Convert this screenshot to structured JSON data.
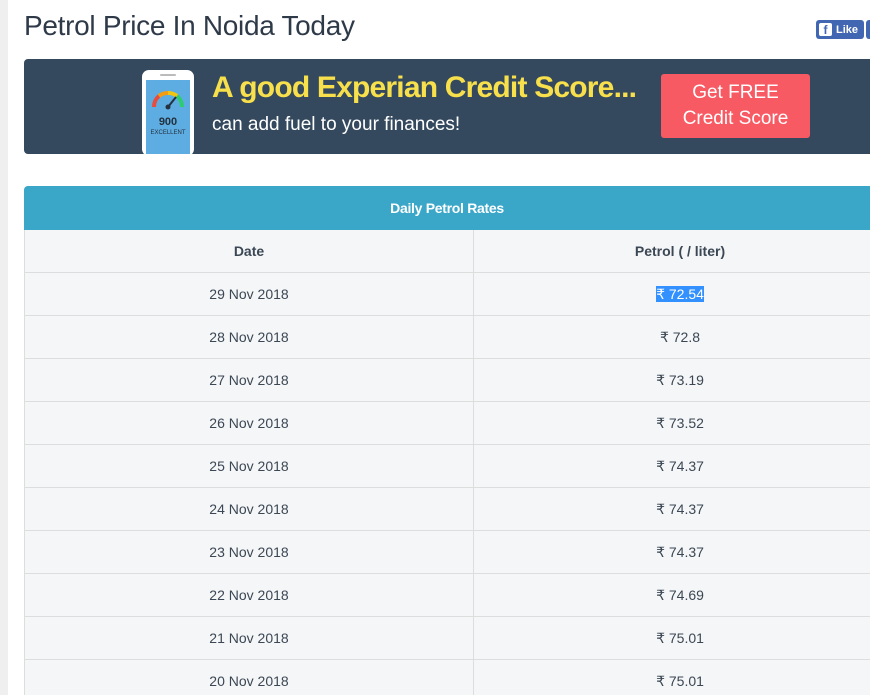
{
  "page": {
    "title": "Petrol Price In Noida Today"
  },
  "social": {
    "like_label": "Like",
    "fb_glyph": "f"
  },
  "banner": {
    "headline": "A good Experian Credit Score...",
    "subtext": "can add fuel to your finances!",
    "cta": {
      "line1": "Get FREE",
      "line2": "Credit Score"
    },
    "phone": {
      "score": "900",
      "label": "EXCELLENT"
    },
    "colors": {
      "background": "#34495e",
      "headline": "#f7e04b",
      "cta": "#f75a63",
      "phone_screen": "#5dade2"
    }
  },
  "rates": {
    "title": "Daily Petrol Rates",
    "columns": [
      "Date",
      "Petrol ( / liter)"
    ],
    "rows": [
      {
        "date": "29 Nov 2018",
        "price": "₹ 72.54",
        "selected": true
      },
      {
        "date": "28 Nov 2018",
        "price": "₹ 72.8"
      },
      {
        "date": "27 Nov 2018",
        "price": "₹ 73.19"
      },
      {
        "date": "26 Nov 2018",
        "price": "₹ 73.52"
      },
      {
        "date": "25 Nov 2018",
        "price": "₹ 74.37"
      },
      {
        "date": "24 Nov 2018",
        "price": "₹ 74.37"
      },
      {
        "date": "23 Nov 2018",
        "price": "₹ 74.37"
      },
      {
        "date": "22 Nov 2018",
        "price": "₹ 74.69"
      },
      {
        "date": "21 Nov 2018",
        "price": "₹ 75.01"
      },
      {
        "date": "20 Nov 2018",
        "price": "₹ 75.01"
      }
    ],
    "colors": {
      "header": "#3aa7c9",
      "row_bg": "#f5f6f7",
      "selection": "#3390ff"
    }
  }
}
